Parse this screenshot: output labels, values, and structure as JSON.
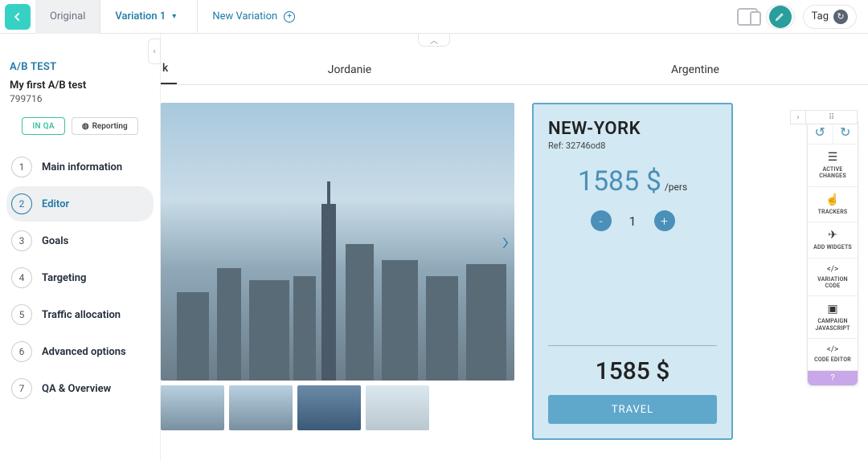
{
  "topbar": {
    "tabs": {
      "original": "Original",
      "variation": "Variation 1",
      "new": "New Variation"
    },
    "tag": "Tag"
  },
  "sidebar": {
    "type": "A/B TEST",
    "name": "My first A/B test",
    "id": "799716",
    "badges": {
      "qa": "IN QA",
      "reporting": "Reporting"
    },
    "steps": [
      {
        "n": "1",
        "label": "Main information"
      },
      {
        "n": "2",
        "label": "Editor"
      },
      {
        "n": "3",
        "label": "Goals"
      },
      {
        "n": "4",
        "label": "Targeting"
      },
      {
        "n": "5",
        "label": "Traffic allocation"
      },
      {
        "n": "6",
        "label": "Advanced options"
      },
      {
        "n": "7",
        "label": "QA & Overview"
      }
    ]
  },
  "preview": {
    "tabs": [
      "k",
      "Jordanie",
      "Argentine"
    ],
    "card": {
      "title": "NEW-YORK",
      "ref": "Ref: 32746od8",
      "price": "1585 $",
      "per": "/pers",
      "qty": "1",
      "total": "1585 $",
      "cta": "TRAVEL"
    }
  },
  "rpanel": {
    "items": [
      {
        "icon": "☰",
        "label": "ACTIVE CHANGES"
      },
      {
        "icon": "☝",
        "label": "TRACKERS"
      },
      {
        "icon": "➤",
        "label": "ADD WIDGETS"
      },
      {
        "icon": "</>",
        "label": "VARIATION CODE"
      },
      {
        "icon": "▣",
        "label": "CAMPAIGN JAVASCRIPT"
      },
      {
        "icon": "</>",
        "label": "CODE EDITOR"
      }
    ]
  }
}
